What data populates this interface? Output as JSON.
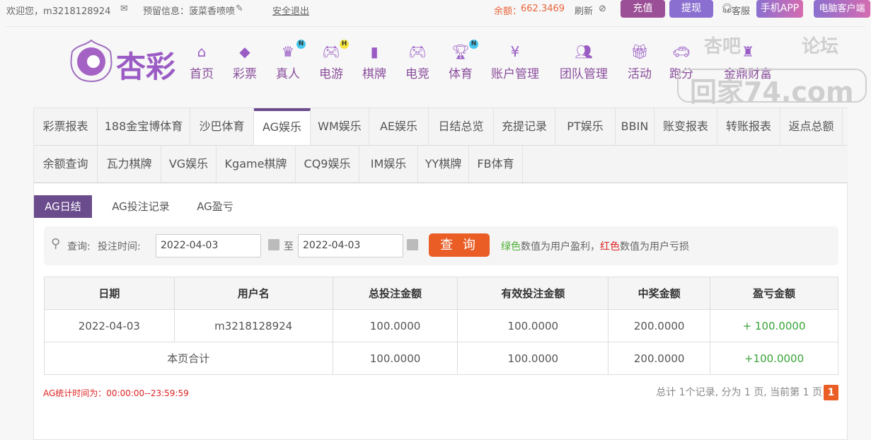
{
  "topbar": {
    "welcome": "欢迎您，m3218128924",
    "message": "预留信息：菠菜香喷喷",
    "logout": "安全退出",
    "balance_label": "余额：",
    "balance": "662.3469",
    "refresh": "刷新",
    "recharge": "充值",
    "withdraw": "提现",
    "service": "客服",
    "mobile_app": "手机APP",
    "pc_client": "电脑客户端"
  },
  "nav": [
    {
      "label": "首页",
      "icon": "home-icon"
    },
    {
      "label": "彩票",
      "icon": "ticket-icon"
    },
    {
      "label": "真人",
      "icon": "dealer-icon",
      "badge": "N"
    },
    {
      "label": "电游",
      "icon": "gamepad-icon",
      "badge": "H"
    },
    {
      "label": "棋牌",
      "icon": "cards-icon"
    },
    {
      "label": "电竞",
      "icon": "gamepad-icon"
    },
    {
      "label": "体育",
      "icon": "trophy-icon",
      "badge": "N"
    },
    {
      "label": "账户管理",
      "icon": "coin-icon"
    },
    {
      "label": "团队管理",
      "icon": "team-icon"
    },
    {
      "label": "活动",
      "icon": "gift-icon"
    },
    {
      "label": "跑分",
      "icon": "car-icon"
    },
    {
      "label": "金鼎财富",
      "icon": "cauldron-icon"
    }
  ],
  "logo_text": "杏彩",
  "watermark": {
    "line1": "杏吧",
    "line2": "论坛",
    "line3": "回家74.com"
  },
  "tabs_row1": [
    "彩票报表",
    "188金宝博体育",
    "沙巴体育",
    "AG娱乐",
    "WM娱乐",
    "AE娱乐",
    "日结总览",
    "充提记录",
    "PT娱乐",
    "BBIN",
    "账变报表",
    "转账报表",
    "返点总额"
  ],
  "tabs_row2": [
    "余额查询",
    "瓦力棋牌",
    "VG娱乐",
    "Kgame棋牌",
    "CQ9娱乐",
    "IM娱乐",
    "YY棋牌",
    "FB体育"
  ],
  "subtabs": [
    "AG日结",
    "AG投注记录",
    "AG盈亏"
  ],
  "search": {
    "label": "查询:",
    "time_label": "投注时间:",
    "start": "2022-04-03",
    "to": "至",
    "end": "2022-04-03",
    "button": "查 询",
    "hint_green": "绿色",
    "hint_mid": "数值为用户盈利，",
    "hint_red": "红色",
    "hint_end": "数值为用户亏损"
  },
  "table": {
    "headers": [
      "日期",
      "用户名",
      "总投注金额",
      "有效投注金额",
      "中奖金额",
      "盈亏金额"
    ],
    "row": [
      "2022-04-03",
      "m3218128924",
      "100.0000",
      "100.0000",
      "200.0000",
      "+ 100.0000"
    ],
    "total": [
      "本页合计",
      "100.0000",
      "100.0000",
      "200.0000",
      "+100.0000"
    ]
  },
  "footer": {
    "stat_time": "AG统计时间为：00:00:00--23:59:59",
    "summary": "总计 1个记录, 分为 1 页, 当前第 1 页",
    "page": "1"
  }
}
